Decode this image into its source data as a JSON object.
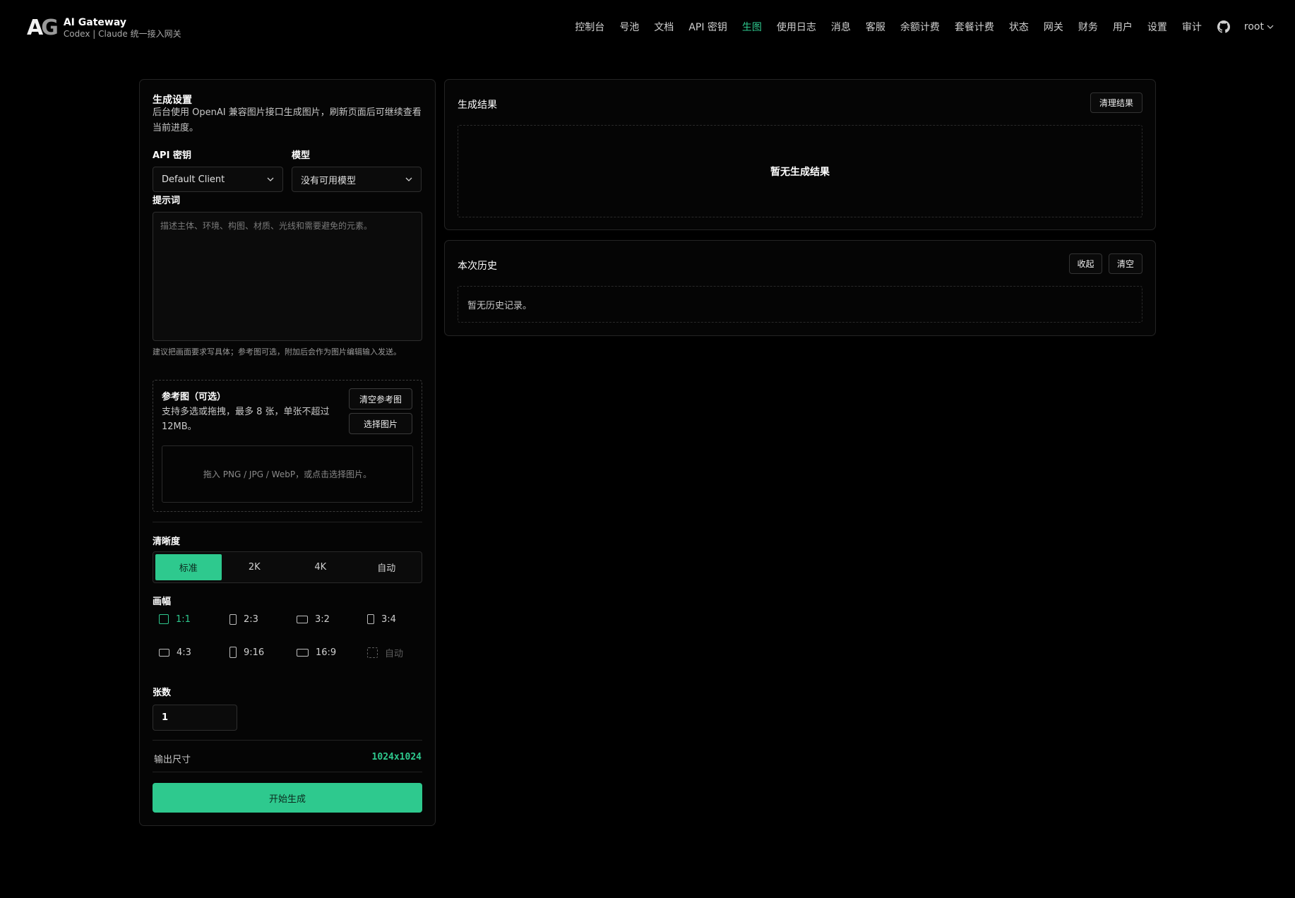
{
  "brand": {
    "mark_a": "A",
    "mark_g": "G",
    "title": "AI Gateway",
    "subtitle": "Codex | Claude 统一接入网关"
  },
  "nav": {
    "items": [
      "控制台",
      "号池",
      "文档",
      "API 密钥",
      "生图",
      "使用日志",
      "消息",
      "客服",
      "余额计费",
      "套餐计费",
      "状态",
      "网关",
      "财务",
      "用户",
      "设置",
      "审计"
    ],
    "active": "生图",
    "github_icon": "github-icon",
    "user": "root"
  },
  "settings": {
    "title": "生成设置",
    "description": "后台使用 OpenAI 兼容图片接口生成图片，刷新页面后可继续查看当前进度。",
    "api_key_label": "API 密钥",
    "api_key_value": "Default Client",
    "model_label": "模型",
    "model_value": "没有可用模型",
    "prompt_label": "提示词",
    "prompt_placeholder": "描述主体、环境、构图、材质、光线和需要避免的元素。",
    "prompt_hint": "建议把画面要求写具体；参考图可选，附加后会作为图片编辑输入发送。",
    "reference": {
      "title": "参考图（可选）",
      "description": "支持多选或拖拽，最多 8 张，单张不超过 12MB。",
      "clear_label": "清空参考图",
      "choose_label": "选择图片",
      "drop_text": "拖入 PNG / JPG / WebP，或点击选择图片。"
    },
    "quality_label": "清晰度",
    "quality_options": [
      "标准",
      "2K",
      "4K",
      "自动"
    ],
    "quality_selected": "标准",
    "ratio_label": "画幅",
    "ratios": [
      "1:1",
      "2:3",
      "3:2",
      "3:4",
      "4:3",
      "9:16",
      "16:9",
      "自动"
    ],
    "ratio_selected": "1:1",
    "count_label": "张数",
    "count_value": "1",
    "output_label": "输出尺寸",
    "output_value": "1024x1024",
    "submit_label": "开始生成"
  },
  "result": {
    "title": "生成结果",
    "clear_label": "清理结果",
    "empty_text": "暂无生成结果"
  },
  "history": {
    "title": "本次历史",
    "collapse_label": "收起",
    "clear_label": "清空",
    "empty_text": "暂无历史记录。"
  },
  "colors": {
    "accent": "#2ec98e",
    "background": "#000000",
    "card_border": "#242424"
  }
}
